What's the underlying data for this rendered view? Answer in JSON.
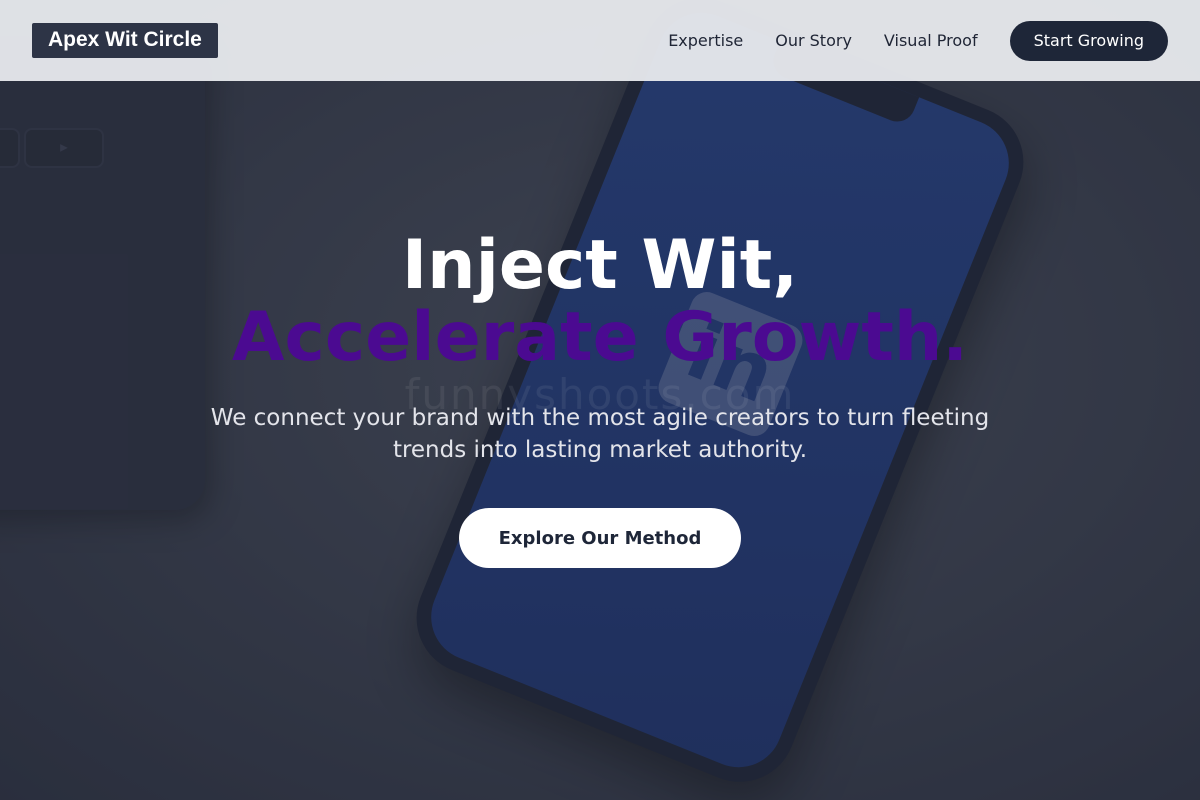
{
  "brand": {
    "name": "Apex Wit Circle"
  },
  "nav": {
    "links": [
      {
        "label": "Expertise"
      },
      {
        "label": "Our Story"
      },
      {
        "label": "Visual Proof"
      }
    ],
    "cta_label": "Start Growing"
  },
  "hero": {
    "headline_line1": "Inject Wit,",
    "headline_line2": "Accelerate Growth.",
    "subtitle": "We connect your brand with the most agile creators to turn fleeting trends into lasting market authority.",
    "cta_label": "Explore Our Method",
    "background_image": {
      "logo_text": "in",
      "watermark_text": "funnyshoots.com",
      "tablet_key_glyph": "▶"
    }
  },
  "colors": {
    "nav_bg": "#e6e8ec",
    "logo_bg": "#2d3446",
    "cta_dark": "#1e2638",
    "accent_purple": "#4b0a91",
    "phone_screen_blue": "#1f3a80"
  },
  "icons": {
    "linkedin_logo": "linkedin-icon",
    "play_glyph": "play-icon"
  }
}
